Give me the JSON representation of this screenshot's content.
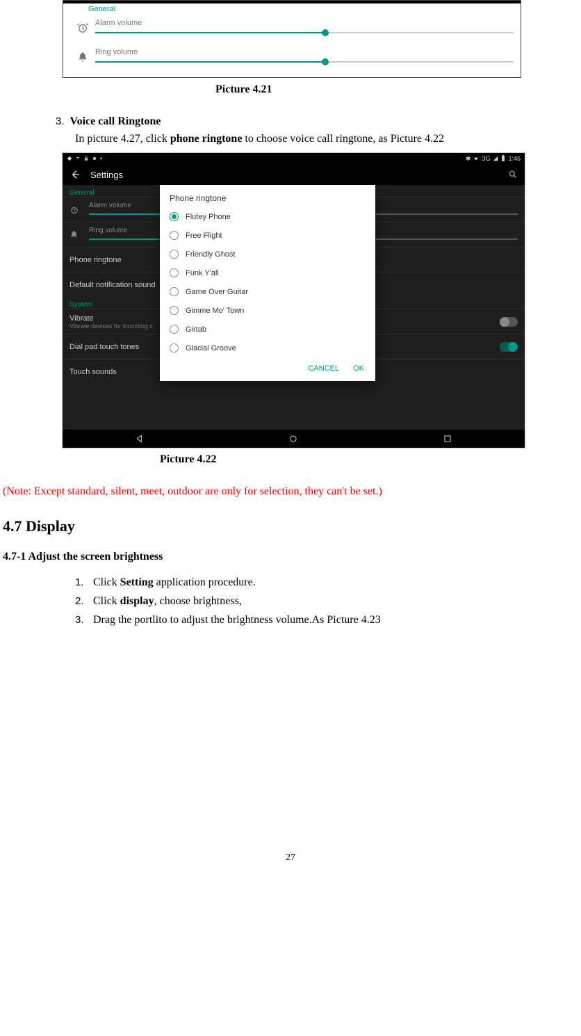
{
  "screenshot1": {
    "section": "General",
    "sliders": [
      {
        "label": "Alarm volume",
        "percent": 55
      },
      {
        "label": "Ring volume",
        "percent": 55
      }
    ]
  },
  "caption_421": "Picture 4.21",
  "section3": {
    "num": "3.",
    "title": "Voice call Ringtone",
    "body_pre": "In picture 4.27, click ",
    "body_bold": "phone ringtone",
    "body_post": " to choose voice call ringtone, as Picture 4.22"
  },
  "screenshot2": {
    "statusbar": {
      "bt": "✱",
      "net": "3G",
      "sig": "▮",
      "batt": "▮",
      "time": "1:46"
    },
    "appbar_title": "Settings",
    "general": "General",
    "slider_alarm": "Alarm volume",
    "slider_ring": "Ring volume",
    "slider_alarm_pct": 45,
    "slider_ring_pct": 45,
    "rows": {
      "phone_ringtone": "Phone ringtone",
      "default_notif": "Default notification sound",
      "system": "System",
      "vibrate": "Vibrate",
      "vibrate_sub": "Vibrate devices for incoming c",
      "dial_pad": "Dial pad touch tones",
      "touch_sounds": "Touch sounds"
    },
    "dialog": {
      "title": "Phone ringtone",
      "options": [
        "Flutey Phone",
        "Free Flight",
        "Friendly Ghost",
        "Funk Y'all",
        "Game Over Guitar",
        "Gimme Mo' Town",
        "Girtab",
        "Glacial Groove"
      ],
      "selected": "Flutey Phone",
      "cancel": "CANCEL",
      "ok": "OK"
    }
  },
  "caption_422": "Picture 4.22",
  "note": "(Note: Except standard, silent, meet, outdoor are only for selection, they can't be set.)",
  "heading_47": "4.7 Display",
  "heading_471": "4.7-1 Adjust the screen brightness",
  "steps": [
    {
      "num": "1.",
      "pre": "Click ",
      "bold": "Setting",
      "post": " application procedure."
    },
    {
      "num": "2.",
      "pre": "Click ",
      "bold": "display",
      "post": ", choose brightness,"
    },
    {
      "num": "3.",
      "pre": "Drag the portlito to adjust the brightness volume.As Picture 4.23",
      "bold": "",
      "post": ""
    }
  ],
  "page_num": "27"
}
